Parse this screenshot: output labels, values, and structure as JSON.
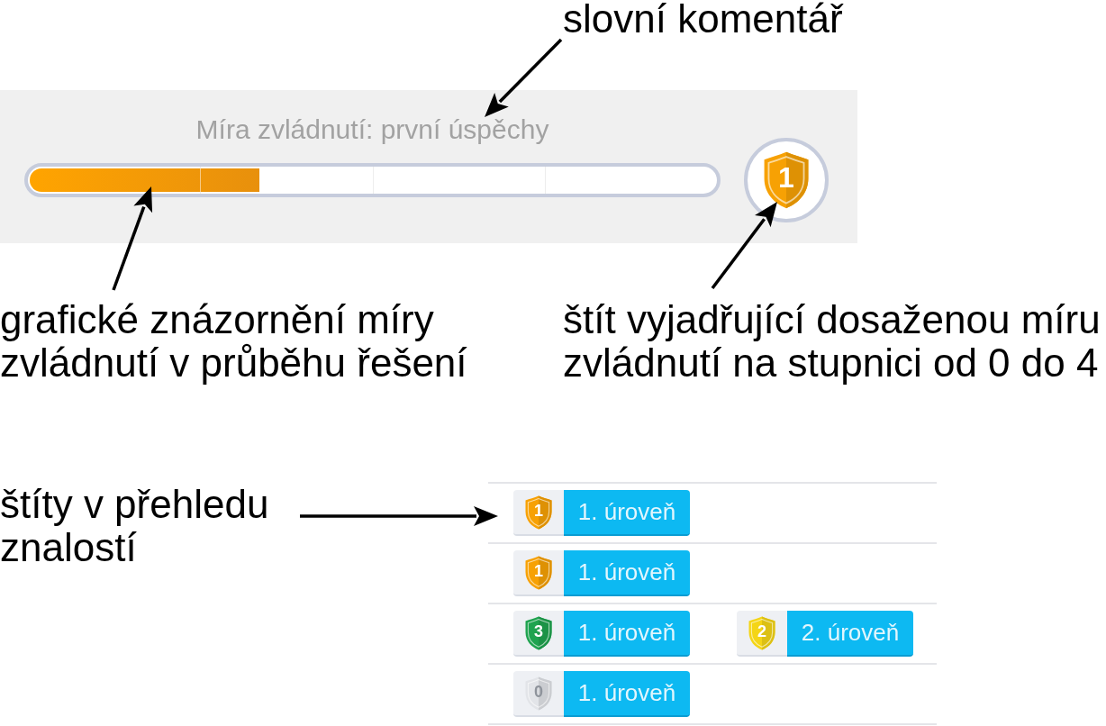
{
  "annotations": [
    {
      "text": "slovní komentář"
    },
    {
      "text": "grafické znázornění míry\nzvládnutí v průběhu řešení"
    },
    {
      "text": "štít vyjadřující dosaženou míru\nzvládnutí na stupnici od 0 do 4"
    },
    {
      "text": "štíty v přehledu\nznalostí"
    }
  ],
  "mastery_panel": {
    "comment": "Míra zvládnutí: první úspěchy",
    "progress": {
      "level": 0.335
    },
    "shield": {
      "number": "1",
      "color": "#f7a104"
    }
  },
  "knowledge_overview": {
    "rows": [
      {
        "badges": [
          {
            "shield": {
              "number": "1",
              "color": "#f7a104"
            },
            "label": "1. úroveň"
          }
        ]
      },
      {
        "badges": [
          {
            "shield": {
              "number": "1",
              "color": "#f7a104"
            },
            "label": "1. úroveň"
          }
        ]
      },
      {
        "badges": [
          {
            "shield": {
              "number": "3",
              "color": "#1fa34f"
            },
            "label": "1. úroveň"
          },
          {
            "shield": {
              "number": "2",
              "color": "#f4d516"
            },
            "label": "2. úroveň"
          }
        ]
      },
      {
        "badges": [
          {
            "shield": {
              "number": "0",
              "color": "#e2e4e8"
            },
            "label": "1. úroveň"
          }
        ]
      }
    ]
  }
}
